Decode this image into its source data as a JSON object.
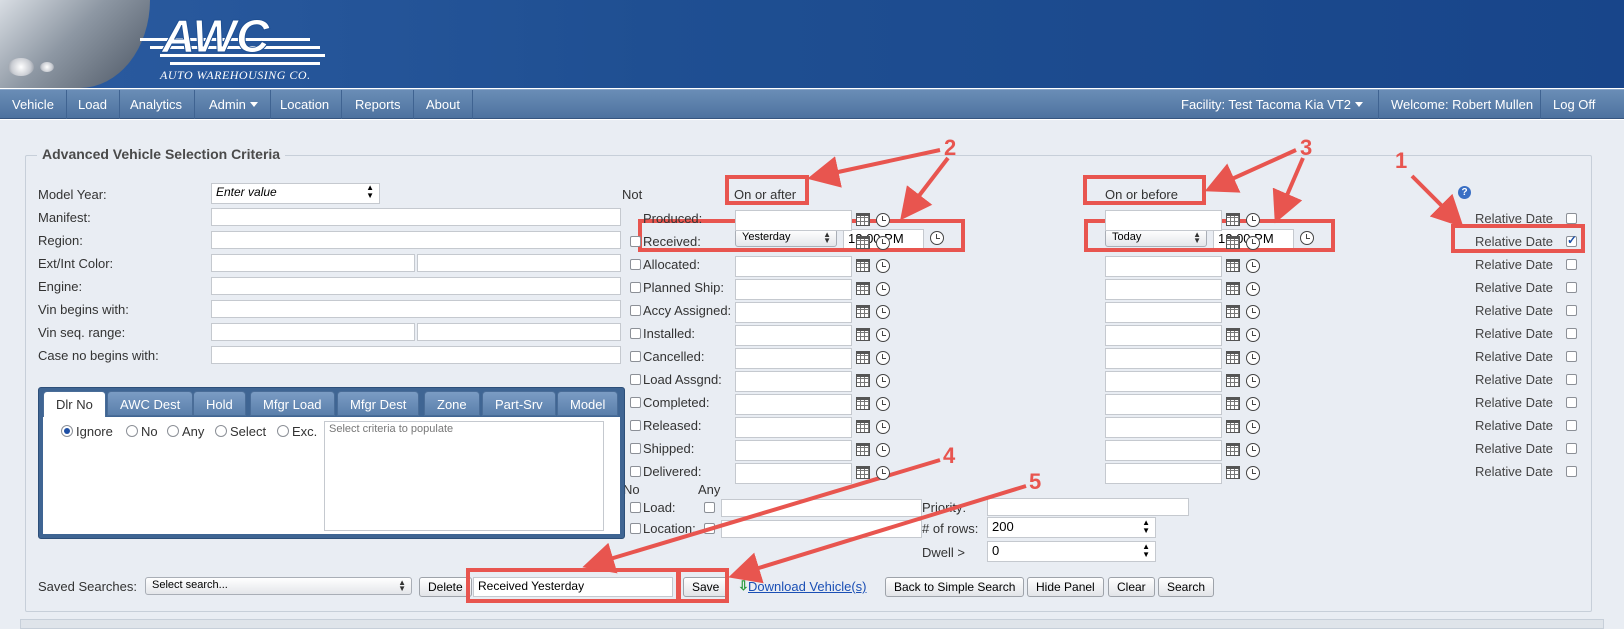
{
  "header": {
    "logo_text": "AWC",
    "logo_subtitle": "AUTO WAREHOUSING CO."
  },
  "nav": {
    "items": [
      "Vehicle",
      "Load",
      "Analytics",
      "Admin",
      "Location",
      "Reports",
      "About"
    ],
    "facility": "Facility: Test Tacoma Kia VT2",
    "welcome": "Welcome: Robert Mullen",
    "logoff": "Log Off"
  },
  "panel": {
    "title": "Advanced Vehicle Selection Criteria",
    "fields": {
      "model_year": "Model Year:",
      "model_year_placeholder": "Enter value",
      "manifest": "Manifest:",
      "region": "Region:",
      "color": "Ext/Int Color:",
      "engine": "Engine:",
      "vin_begins": "Vin begins with:",
      "vin_seq": "Vin seq. range:",
      "case_no": "Case no begins with:"
    },
    "dates": {
      "not_label": "Not",
      "on_or_after": "On or after",
      "on_or_before": "On or before",
      "relative_date": "Relative Date",
      "rows": [
        "Produced:",
        "Received:",
        "Allocated:",
        "Planned Ship:",
        "Accy Assigned:",
        "Installed:",
        "Cancelled:",
        "Load Assgnd:",
        "Completed:",
        "Released:",
        "Shipped:",
        "Delivered:"
      ],
      "received_after_select": "Yesterday",
      "received_after_time": "12:00 PM",
      "received_before_select": "Today",
      "received_before_time": "12:00 PM"
    },
    "extra": {
      "no_label": "No",
      "any_label": "Any",
      "load_label": "Load:",
      "location_label": "Location:",
      "priority_label": "Priority:",
      "rows_label": "# of rows:",
      "rows_value": "200",
      "dwell_label": "Dwell >",
      "dwell_value": "0"
    },
    "tabs": [
      "Dlr No",
      "AWC Dest",
      "Hold",
      "Mfgr Load",
      "Mfgr Dest",
      "Zone",
      "Part-Srv",
      "Model"
    ],
    "radios": [
      "Ignore",
      "No",
      "Any",
      "Select",
      "Exc."
    ],
    "criteria_placeholder": "Select criteria to populate",
    "saved": {
      "label": "Saved Searches:",
      "select": "Select search...",
      "delete": "Delete",
      "name_value": "Received Yesterday",
      "save": "Save",
      "download": "Download Vehicle(s)",
      "back": "Back to Simple Search",
      "hide": "Hide Panel",
      "clear": "Clear",
      "search": "Search"
    }
  },
  "annotations": [
    "1",
    "2",
    "3",
    "4",
    "5"
  ],
  "colors": {
    "annotation": "#e8554f",
    "nav": "#5a7fab",
    "header": "#1f4f92",
    "panel_bg": "#e9edf3"
  }
}
